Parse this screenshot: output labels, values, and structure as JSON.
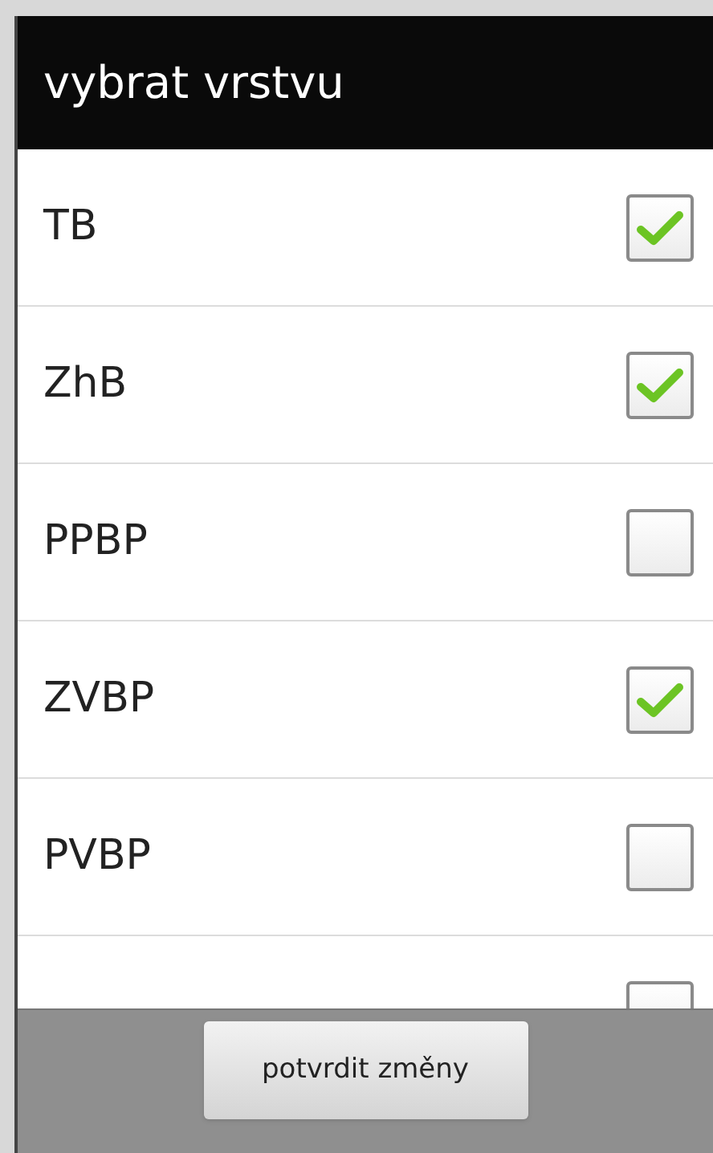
{
  "dialog": {
    "title": "vybrat vrstvu"
  },
  "layers": [
    {
      "label": "TB",
      "checked": true
    },
    {
      "label": "ZhB",
      "checked": true
    },
    {
      "label": "PPBP",
      "checked": false
    },
    {
      "label": "ZVBP",
      "checked": true
    },
    {
      "label": "PVBP",
      "checked": false
    },
    {
      "checked": false
    }
  ],
  "buttons": [
    {
      "label": "potvrdit změny"
    }
  ]
}
